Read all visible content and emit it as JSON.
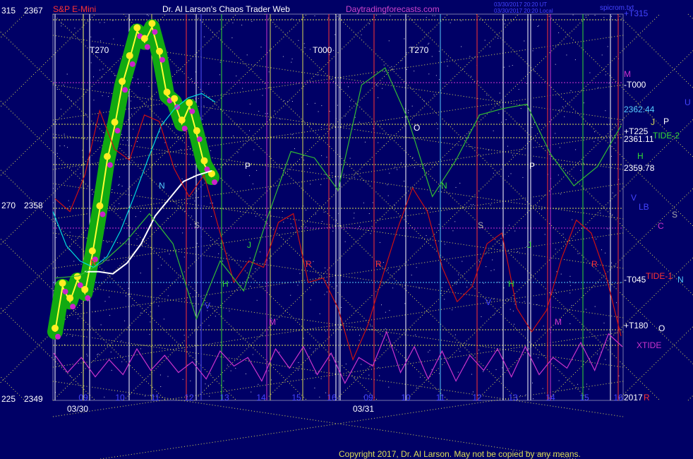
{
  "chart_data": {
    "type": "line",
    "title": "S&P E-Mini",
    "header_center": "Dr. Al Larson's Chaos Trader Web",
    "header_site": "Daytradingforecasts.com",
    "header_stamp_1": "03/30/2017 20:20 UT",
    "header_stamp_2": "03/30/2017 20:20 Local",
    "header_right": "spicrom.txt",
    "copyright": "Copyright 2017, Dr. Al Larson. May not be copied by any means.",
    "left_axis": [
      {
        "label": "315",
        "value": "2367"
      },
      {
        "label": "270",
        "value": "2358"
      },
      {
        "label": "225",
        "value": "2349"
      }
    ],
    "ylim": [
      2349,
      2367
    ],
    "date_labels": [
      "03/30",
      "03/31"
    ],
    "hour_ticks_day1": [
      "09",
      "10",
      "11",
      "12",
      "13",
      "14",
      "15",
      "16"
    ],
    "hour_ticks_day2": [
      "09",
      "10",
      "11",
      "12",
      "13",
      "14",
      "15",
      "16"
    ],
    "price_levels": [
      {
        "label": "2362.44",
        "value": 2362.44
      },
      {
        "label": "2361.11",
        "value": 2361.11
      },
      {
        "label": "2359.78",
        "value": 2359.78
      }
    ],
    "line_labels": [
      "+T315",
      "-T000",
      "+T225",
      "-T045",
      "+T180",
      "2017"
    ],
    "planet_labels": [
      "M",
      "U",
      "J",
      "P",
      "TIDE-2",
      "H",
      "V",
      "LB",
      "S",
      "C",
      "TIDE-1",
      "N",
      "O",
      "XTIDE",
      "R"
    ],
    "chart_letters": [
      "T270",
      "T000",
      "T270",
      "N",
      "P",
      "S",
      "J",
      "H",
      "R",
      "M",
      "V",
      "O",
      "N",
      "P",
      "S",
      "J",
      "H",
      "R",
      "M",
      "V",
      "R",
      "R"
    ],
    "series": [
      {
        "name": "price",
        "color": "#33dd33",
        "values": [
          2352.2,
          2354.3,
          2353.6,
          2354.6,
          2354.0,
          2355.8,
          2357.9,
          2360.2,
          2361.8,
          2363.7,
          2364.9,
          2366.2,
          2365.7,
          2366.4,
          2365.1,
          2363.2,
          2362.9,
          2361.9,
          2362.7,
          2361.4,
          2360.0,
          2359.4
        ]
      },
      {
        "name": "eur",
        "color": "#00dddd",
        "values": [
          2357.8,
          2356.2,
          2355.5,
          2355.2,
          2355.7,
          2356.9,
          2358.5,
          2360.2,
          2361.8,
          2362.6,
          2363.1,
          2363.3,
          2362.9
        ]
      },
      {
        "name": "white",
        "color": "#ffffff",
        "values": [
          2355.0,
          2355.0,
          2354.9,
          2355.4,
          2356.3,
          2357.6,
          2358.4,
          2359.2,
          2359.5,
          2359.7
        ]
      },
      {
        "name": "red",
        "color": "#cc1111",
        "values": [
          2358.4,
          2357.8,
          2359.5,
          2362.5,
          2360.7,
          2360.2,
          2362.3,
          2362.0,
          2359.8,
          2358.5,
          2359.5,
          2357.0,
          2354.5,
          2355.5,
          2355.2,
          2357.3,
          2357.7,
          2354.5,
          2354.7,
          2353.3,
          2350.9,
          2352.5,
          2354.8,
          2357.0,
          2358.9,
          2357.8,
          2355.2,
          2353.6,
          2354.3,
          2356.3,
          2356.8,
          2353.3,
          2352.2,
          2353.2,
          2355.6,
          2357.4,
          2356.8,
          2354.8,
          2352.0
        ]
      },
      {
        "name": "green",
        "color": "#33bb33",
        "values": [
          2354.7,
          2354.8,
          2355.4,
          2356.4,
          2357.7,
          2356.3,
          2352.8,
          2355.5,
          2354.1,
          2357.5,
          2360.6,
          2360.3,
          2358.8,
          2363.7,
          2364.5,
          2362.0,
          2358.5,
          2360.2,
          2362.3,
          2362.6,
          2362.8,
          2360.5,
          2359.0,
          2359.9,
          2361.8
        ]
      },
      {
        "name": "XTIDE",
        "color": "#cc33cc",
        "values": [
          2351.2,
          2350.3,
          2351.0,
          2350.1,
          2350.9,
          2350.2,
          2351.4,
          2350.4,
          2351.1,
          2350.3,
          2350.8,
          2350.0,
          2351.3,
          2350.6,
          2351.0,
          2349.9,
          2351.4,
          2350.5,
          2351.5,
          2350.2,
          2351.2,
          2349.8,
          2351.0,
          2350.6,
          2352.2,
          2350.3,
          2351.5,
          2350.0,
          2351.3,
          2349.9,
          2351.1,
          2350.4,
          2351.4,
          2350.1,
          2351.5,
          2350.2,
          2351.0,
          2350.5,
          2351.7,
          2350.4,
          2352.1,
          2351.5
        ]
      }
    ],
    "grid": "off",
    "legend": "none"
  }
}
